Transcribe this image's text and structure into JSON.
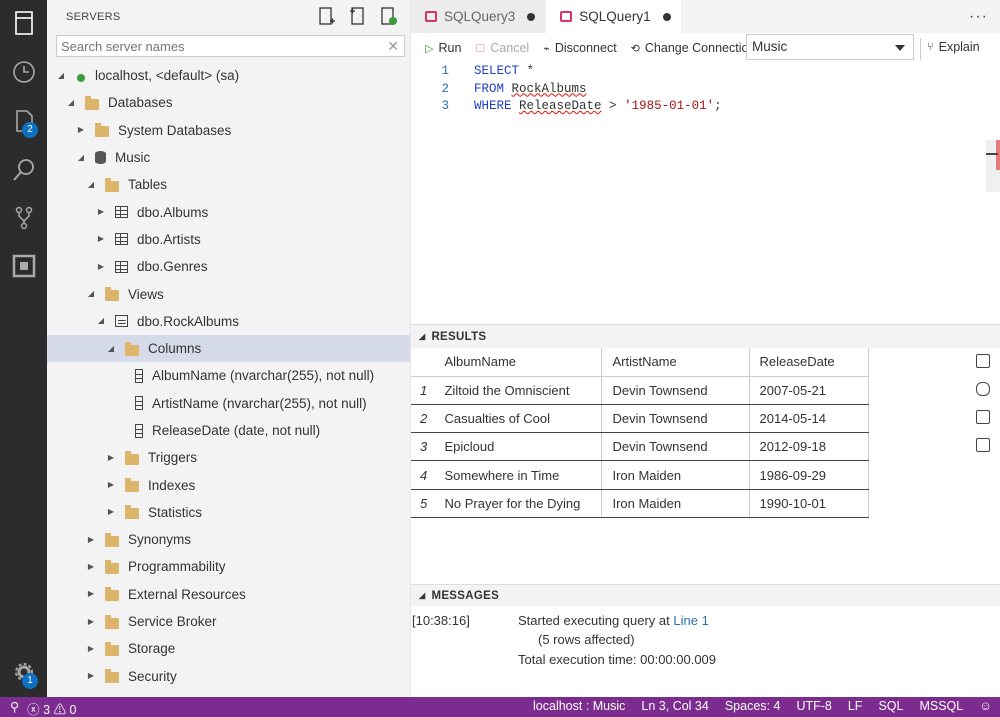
{
  "activity_bar": {
    "items": [
      {
        "icon": "servers-icon"
      },
      {
        "icon": "history-icon"
      },
      {
        "icon": "files-icon",
        "badge": "2"
      },
      {
        "icon": "search-icon"
      },
      {
        "icon": "source-control-icon"
      },
      {
        "icon": "extensions-icon"
      }
    ],
    "settings_badge": "1"
  },
  "sidebar": {
    "title": "SERVERS",
    "search_placeholder": "Search server names",
    "tree": [
      {
        "label": "localhost, <default> (sa)",
        "depth": 0,
        "twisty": "open",
        "icon": "server"
      },
      {
        "label": "Databases",
        "depth": 1,
        "twisty": "open",
        "icon": "folder"
      },
      {
        "label": "System Databases",
        "depth": 2,
        "twisty": "closed",
        "icon": "folder"
      },
      {
        "label": "Music",
        "depth": 2,
        "twisty": "open",
        "icon": "db"
      },
      {
        "label": "Tables",
        "depth": 3,
        "twisty": "open",
        "icon": "folder"
      },
      {
        "label": "dbo.Albums",
        "depth": 4,
        "twisty": "closed",
        "icon": "tbl"
      },
      {
        "label": "dbo.Artists",
        "depth": 4,
        "twisty": "closed",
        "icon": "tbl"
      },
      {
        "label": "dbo.Genres",
        "depth": 4,
        "twisty": "closed",
        "icon": "tbl"
      },
      {
        "label": "Views",
        "depth": 3,
        "twisty": "open",
        "icon": "folder"
      },
      {
        "label": "dbo.RockAlbums",
        "depth": 4,
        "twisty": "open",
        "icon": "view"
      },
      {
        "label": "Columns",
        "depth": 5,
        "twisty": "open",
        "icon": "folder",
        "selected": true
      },
      {
        "label": "AlbumName (nvarchar(255), not null)",
        "depth": 6,
        "twisty": "none",
        "icon": "col"
      },
      {
        "label": "ArtistName (nvarchar(255), not null)",
        "depth": 6,
        "twisty": "none",
        "icon": "col"
      },
      {
        "label": "ReleaseDate (date, not null)",
        "depth": 6,
        "twisty": "none",
        "icon": "col"
      },
      {
        "label": "Triggers",
        "depth": 5,
        "twisty": "closed",
        "icon": "folder"
      },
      {
        "label": "Indexes",
        "depth": 5,
        "twisty": "closed",
        "icon": "folder"
      },
      {
        "label": "Statistics",
        "depth": 5,
        "twisty": "closed",
        "icon": "folder"
      },
      {
        "label": "Synonyms",
        "depth": 3,
        "twisty": "closed",
        "icon": "folder"
      },
      {
        "label": "Programmability",
        "depth": 3,
        "twisty": "closed",
        "icon": "folder"
      },
      {
        "label": "External Resources",
        "depth": 3,
        "twisty": "closed",
        "icon": "folder"
      },
      {
        "label": "Service Broker",
        "depth": 3,
        "twisty": "closed",
        "icon": "folder"
      },
      {
        "label": "Storage",
        "depth": 3,
        "twisty": "closed",
        "icon": "folder"
      },
      {
        "label": "Security",
        "depth": 3,
        "twisty": "closed",
        "icon": "folder"
      }
    ]
  },
  "tabs": [
    {
      "label": "SQLQuery3",
      "active": false
    },
    {
      "label": "SQLQuery1",
      "active": true
    }
  ],
  "toolbar": {
    "run": "Run",
    "cancel": "Cancel",
    "disconnect": "Disconnect",
    "change_connection": "Change Connection",
    "database": "Music",
    "explain": "Explain"
  },
  "code": [
    {
      "num": "1",
      "kw1": "SELECT",
      "rest": " *"
    },
    {
      "num": "2",
      "kw1": "FROM",
      "obj": "RockAlbums"
    },
    {
      "num": "3",
      "kw1": "WHERE",
      "obj": "ReleaseDate",
      "op": " > ",
      "str": "'1985-01-01'",
      "end": ";"
    }
  ],
  "results": {
    "title": "RESULTS",
    "columns": [
      "AlbumName",
      "ArtistName",
      "ReleaseDate"
    ],
    "rows": [
      [
        "1",
        "Ziltoid the Omniscient",
        "Devin Townsend",
        "2007-05-21"
      ],
      [
        "2",
        "Casualties of Cool",
        "Devin Townsend",
        "2014-05-14"
      ],
      [
        "3",
        "Epicloud",
        "Devin Townsend",
        "2012-09-18"
      ],
      [
        "4",
        "Somewhere in Time",
        "Iron Maiden",
        "1986-09-29"
      ],
      [
        "5",
        "No Prayer for the Dying",
        "Iron Maiden",
        "1990-10-01"
      ]
    ]
  },
  "messages": {
    "title": "MESSAGES",
    "time": "[10:38:16]",
    "line1_text": "Started executing query at ",
    "line1_link": "Line 1",
    "line2": "(5 rows affected)",
    "line3": "Total execution time: 00:00:00.009"
  },
  "status": {
    "errors": "3",
    "warnings": "0",
    "connection": "localhost : Music",
    "position": "Ln 3, Col 34",
    "spaces": "Spaces: 4",
    "encoding": "UTF-8",
    "eol": "LF",
    "language": "SQL",
    "provider": "MSSQL"
  }
}
